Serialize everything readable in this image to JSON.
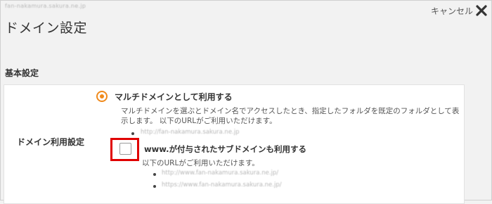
{
  "header": {
    "domain": "fan-nakamura.sakura.ne.jp",
    "title": "ドメイン設定",
    "cancel_label": "キャンセル"
  },
  "section": {
    "title": "基本設定"
  },
  "form": {
    "row_label": "ドメイン利用設定",
    "radio_label": "マルチドメインとして利用する",
    "radio_selected": true,
    "radio_description": "マルチドメインを選ぶとドメイン名でアクセスしたとき、指定したフォルダを既定のフォルダとして表示します。 以下のURLがご利用いただけます。",
    "radio_url": "http://fan-nakamura.sakura.ne.jp",
    "checkbox_label": "www.が付与されたサブドメインも利用する",
    "checkbox_checked": false,
    "checkbox_description": "以下のURLがご利用いただけます。",
    "checkbox_urls": [
      "http://www.fan-nakamura.sakura.ne.jp/",
      "https://www.fan-nakamura.sakura.ne.jp/"
    ]
  },
  "colors": {
    "accent": "#f08a1c",
    "highlight": "#e00000"
  },
  "icons": {
    "close": "close-x-icon"
  }
}
